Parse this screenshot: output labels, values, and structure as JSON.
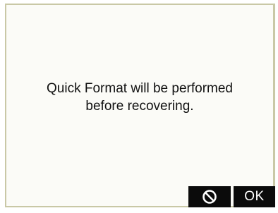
{
  "dialog": {
    "message_line1": "Quick Format will be performed",
    "message_line2": "before recovering."
  },
  "buttons": {
    "cancel_icon": "prohibited-icon",
    "ok_label": "OK"
  },
  "colors": {
    "button_bg": "#0b0b0b",
    "button_fg": "#ffffff",
    "frame_border": "#c9c8a6"
  }
}
